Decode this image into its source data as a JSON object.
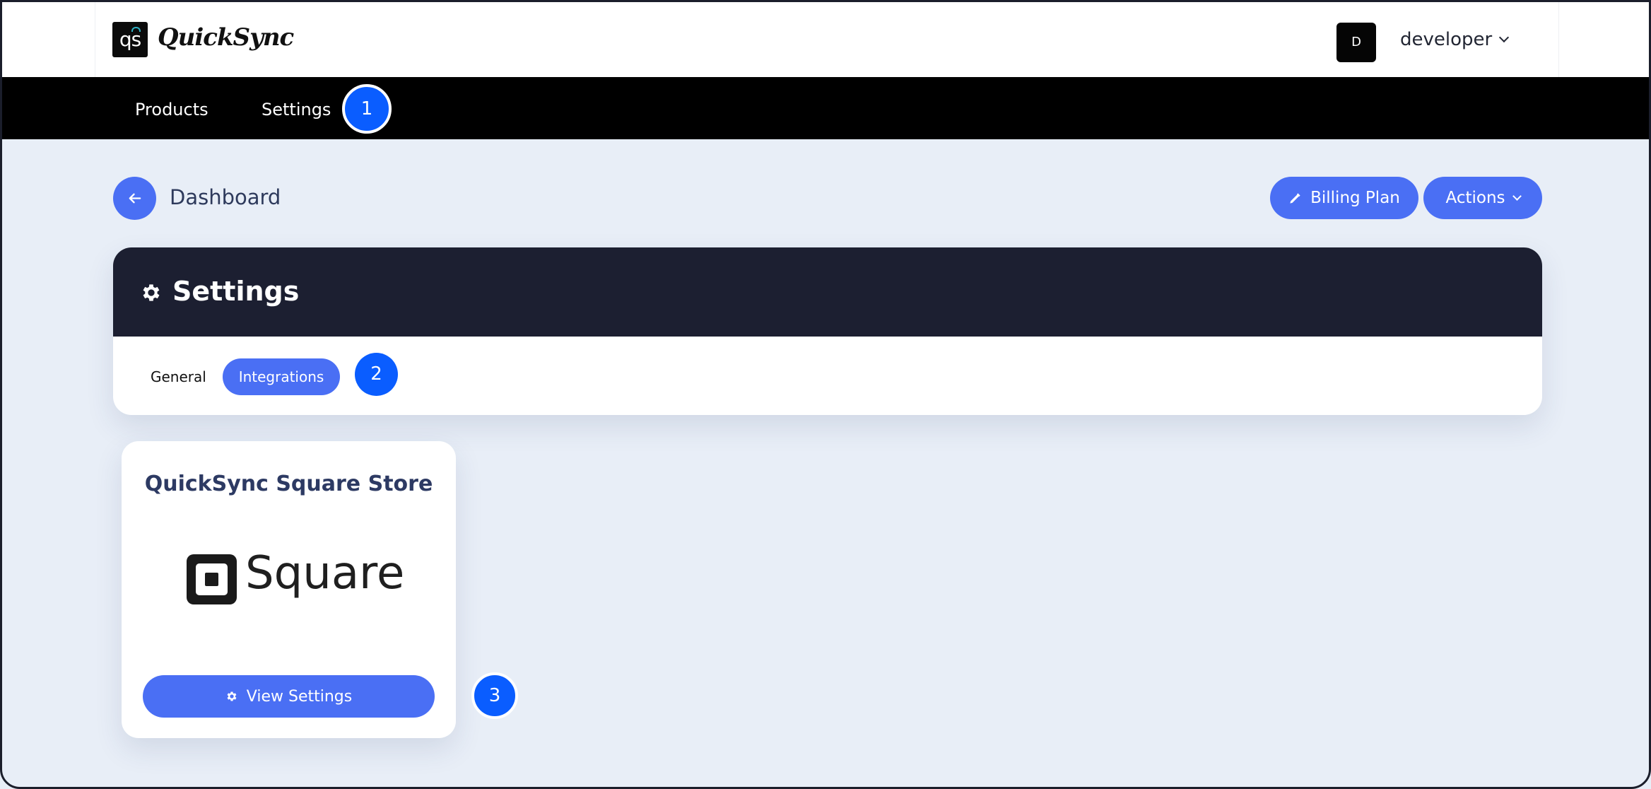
{
  "header": {
    "logo_text": "QuickSync",
    "logo_mark": "qs",
    "avatar_initial": "D",
    "username": "developer"
  },
  "nav": {
    "items": [
      {
        "label": "Products"
      },
      {
        "label": "Settings"
      }
    ]
  },
  "page": {
    "title": "Dashboard",
    "billing_label": "Billing Plan",
    "actions_label": "Actions"
  },
  "settings": {
    "title": "Settings",
    "tabs": [
      {
        "label": "General",
        "active": false
      },
      {
        "label": "Integrations",
        "active": true
      }
    ]
  },
  "integration_card": {
    "title": "QuickSync Square Store",
    "logo_word": "Square",
    "button_label": "View Settings"
  },
  "markers": [
    "1",
    "2",
    "3"
  ],
  "colors": {
    "accent": "#4a6ff4",
    "marker": "#0a5dff",
    "header_dark": "#1c1f31",
    "nav_bg": "#000000",
    "page_bg": "#e8eef7"
  }
}
